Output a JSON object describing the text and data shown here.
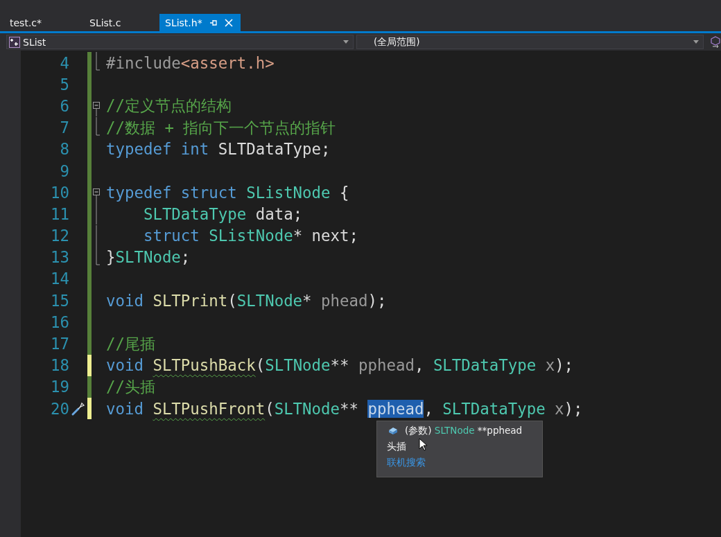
{
  "tabs": [
    {
      "label": "test.c*",
      "selected": false
    },
    {
      "label": "SList.c",
      "selected": false
    },
    {
      "label": "SList.h*",
      "selected": true
    }
  ],
  "nav": {
    "project": "SList",
    "scope": "(全局范围)"
  },
  "lines": [
    {
      "number": "4",
      "kind": "fold-end",
      "unsaved": false,
      "tokens": [
        {
          "kind": "preproc",
          "text": "#include"
        },
        {
          "kind": "header",
          "text": "<assert.h>"
        }
      ]
    },
    {
      "number": "5",
      "kind": "code",
      "unsaved": false
    },
    {
      "number": "6",
      "kind": "code",
      "unsaved": false,
      "expanded": true,
      "tokens": [
        {
          "kind": "comment",
          "text": "//定义节点的结构"
        }
      ],
      "children": [
        {
          "number": "7",
          "kind": "fold-end",
          "unsaved": false,
          "tokens": [
            {
              "kind": "comment",
              "text": "//数据 + 指向下一个节点的指针"
            }
          ]
        }
      ]
    },
    {
      "number": "8",
      "kind": "code",
      "unsaved": false,
      "tokens": [
        {
          "kind": "keyword",
          "text": "typedef int"
        },
        {
          "kind": "plain",
          "text": " SLTDataType;"
        }
      ]
    },
    {
      "number": "9",
      "kind": "code",
      "unsaved": false
    },
    {
      "number": "10",
      "kind": "code",
      "unsaved": false,
      "expanded": true,
      "tokens": [
        {
          "kind": "keyword",
          "text": "typedef struct "
        },
        {
          "kind": "type",
          "text": "SListNode"
        },
        {
          "kind": "plain",
          "text": " {"
        }
      ],
      "children": [
        {
          "number": "11",
          "kind": "code",
          "unsaved": false,
          "tokens": [
            {
              "kind": "type",
              "text": "    SLTDataType"
            },
            {
              "kind": "field",
              "text": " data"
            },
            {
              "kind": "plain",
              "text": ";"
            }
          ]
        },
        {
          "number": "12",
          "kind": "code",
          "unsaved": false,
          "tokens": [
            {
              "kind": "keyword",
              "text": "    struct "
            },
            {
              "kind": "type",
              "text": "SListNode"
            },
            {
              "kind": "plain",
              "text": "*"
            },
            {
              "kind": "field",
              "text": " next"
            },
            {
              "kind": "plain",
              "text": ";"
            }
          ]
        },
        {
          "number": "13",
          "kind": "fold-end",
          "unsaved": false,
          "tokens": [
            {
              "kind": "plain",
              "text": "}"
            },
            {
              "kind": "type",
              "text": "SLTNode"
            },
            {
              "kind": "plain",
              "text": ";"
            }
          ]
        }
      ]
    },
    {
      "number": "14",
      "kind": "code",
      "unsaved": false
    },
    {
      "number": "15",
      "kind": "code",
      "unsaved": false,
      "tokens": [
        {
          "kind": "keyword",
          "text": "void "
        },
        {
          "kind": "func",
          "text": "SLTPrint"
        },
        {
          "kind": "plain",
          "text": "("
        },
        {
          "kind": "type",
          "text": "SLTNode"
        },
        {
          "kind": "plain",
          "text": "*"
        },
        {
          "kind": "param",
          "text": " phead"
        },
        {
          "kind": "plain",
          "text": ");"
        }
      ]
    },
    {
      "number": "16",
      "kind": "code",
      "unsaved": false
    },
    {
      "number": "17",
      "kind": "code",
      "unsaved": false,
      "tokens": [
        {
          "kind": "comment",
          "text": "//尾插"
        }
      ]
    },
    {
      "number": "18",
      "kind": "code",
      "unsaved": true,
      "tokens": [
        {
          "kind": "keyword",
          "text": "void "
        },
        {
          "kind": "func",
          "text": "SLTPushBack",
          "squiggle": true
        },
        {
          "kind": "plain",
          "text": "("
        },
        {
          "kind": "type",
          "text": "SLTNode"
        },
        {
          "kind": "plain",
          "text": "**"
        },
        {
          "kind": "param",
          "text": " pphead"
        },
        {
          "kind": "plain",
          "text": ", "
        },
        {
          "kind": "type",
          "text": "SLTDataType"
        },
        {
          "kind": "param",
          "text": " x"
        },
        {
          "kind": "plain",
          "text": ");"
        }
      ]
    },
    {
      "number": "19",
      "kind": "code",
      "unsaved": false,
      "tokens": [
        {
          "kind": "comment",
          "text": "//头插"
        }
      ]
    },
    {
      "number": "20",
      "kind": "code",
      "unsaved": true,
      "action_icon": true,
      "tokens": [
        {
          "kind": "keyword",
          "text": "void "
        },
        {
          "kind": "func",
          "text": "SLTPushFront",
          "squiggle": true
        },
        {
          "kind": "plain",
          "text": "("
        },
        {
          "kind": "type",
          "text": "SLTNode"
        },
        {
          "kind": "plain",
          "text": "** "
        },
        {
          "kind": "param",
          "text": "pphead",
          "highlighted": true
        },
        {
          "kind": "plain",
          "text": ", "
        },
        {
          "kind": "type",
          "text": "SLTDataType"
        },
        {
          "kind": "param",
          "text": " x"
        },
        {
          "kind": "plain",
          "text": ");"
        }
      ]
    }
  ],
  "tooltip": {
    "prefix": "(参数)",
    "type": "SLTNode",
    "name": "**pphead",
    "description": "头插",
    "link": "联机搜索"
  }
}
